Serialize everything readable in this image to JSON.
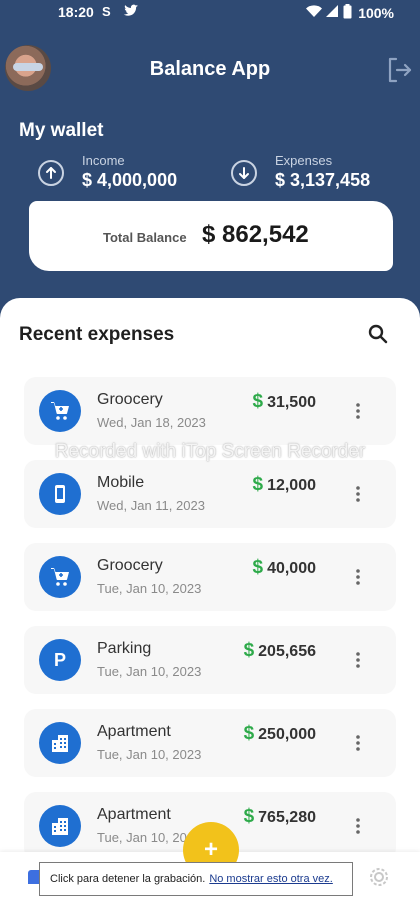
{
  "status_bar": {
    "time": "18:20",
    "notif_s": "S",
    "battery": "100%"
  },
  "header": {
    "title": "Balance App"
  },
  "wallet": {
    "title": "My wallet",
    "income_label": "Income",
    "income_value": "$ 4,000,000",
    "expenses_label": "Expenses",
    "expenses_value": "$ 3,137,458",
    "total_label": "Total Balance",
    "total_value": "$ 862,542"
  },
  "recent": {
    "title": "Recent expenses",
    "items": [
      {
        "name": "Groocery",
        "date": "Wed, Jan 18, 2023",
        "amount": "31,500",
        "icon": "cart-icon"
      },
      {
        "name": "Mobile",
        "date": "Wed, Jan 11, 2023",
        "amount": "12,000",
        "icon": "phone-icon"
      },
      {
        "name": "Groocery",
        "date": "Tue, Jan 10, 2023",
        "amount": "40,000",
        "icon": "cart-icon"
      },
      {
        "name": "Parking",
        "date": "Tue, Jan 10, 2023",
        "amount": "205,656",
        "icon": "parking-icon"
      },
      {
        "name": "Apartment",
        "date": "Tue, Jan 10, 2023",
        "amount": "250,000",
        "icon": "building-icon"
      },
      {
        "name": "Apartment",
        "date": "Tue, Jan 10, 20",
        "amount": "765,280",
        "icon": "building-icon"
      }
    ],
    "currency_symbol": "$"
  },
  "fab": {
    "label": "+"
  },
  "watermark": "Recorded with iTop Screen Recorder",
  "tooltip": {
    "text": "Click para detener la grabación.",
    "link": "No mostrar esto otra vez."
  },
  "colors": {
    "header_bg": "#2f4a73",
    "accent_blue": "#1f6fd1",
    "money_green": "#2eaa4a",
    "fab_yellow": "#f2c21b"
  }
}
